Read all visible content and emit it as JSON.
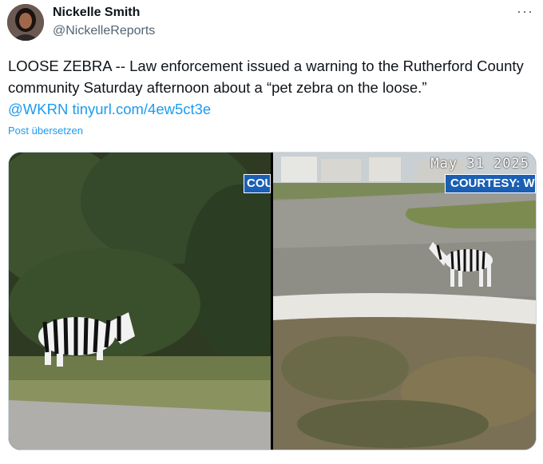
{
  "author": {
    "name": "Nickelle Smith",
    "handle": "@NickelleReports",
    "avatar_icon": "profile-photo"
  },
  "menu": {
    "more_label": "···"
  },
  "post": {
    "text": "LOOSE ZEBRA -- Law enforcement issued a warning to the Rutherford County community Saturday afternoon about a “pet zebra on the loose.”",
    "mention": "@WKRN",
    "url": "tinyurl.com/4ew5ct3e",
    "translate_label": "Post übersetzen"
  },
  "media": {
    "left": {
      "badge": "COU"
    },
    "right": {
      "badge": "COURTESY: W",
      "timestamp": "May 31 2025"
    }
  },
  "colors": {
    "link": "#1d9bf0",
    "badge": "#1a5fb4",
    "text": "#0f1419",
    "secondary": "#536471"
  }
}
